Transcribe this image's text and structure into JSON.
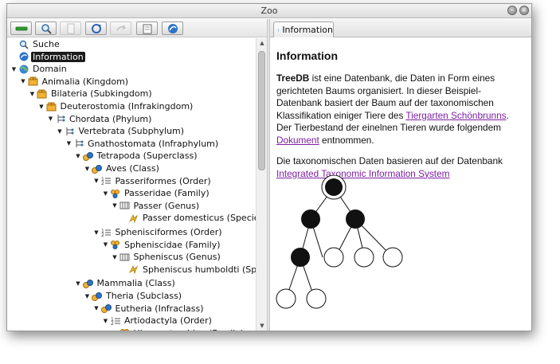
{
  "window": {
    "title": "Zoo"
  },
  "toolbar": {
    "buttons": [
      "minus",
      "search",
      "page",
      "refresh",
      "forward",
      "folder",
      "info"
    ]
  },
  "tree": [
    {
      "label": "Suche",
      "icon": "search",
      "arrow": "",
      "indent": 0,
      "selected": false
    },
    {
      "label": "Information",
      "icon": "info",
      "arrow": "",
      "indent": 0,
      "selected": true
    },
    {
      "label": "Domain",
      "icon": "globe",
      "arrow": "down",
      "indent": 0,
      "selected": false
    },
    {
      "label": "Animalia (Kingdom)",
      "icon": "kingdom",
      "arrow": "down",
      "indent": 1,
      "selected": false
    },
    {
      "label": "Bilateria (Subkingdom)",
      "icon": "kingdom",
      "arrow": "down",
      "indent": 2,
      "selected": false
    },
    {
      "label": "Deuterostomia (Infrakingdom)",
      "icon": "kingdom",
      "arrow": "down",
      "indent": 3,
      "selected": false
    },
    {
      "label": "Chordata (Phylum)",
      "icon": "phylum",
      "arrow": "down",
      "indent": 4,
      "selected": false
    },
    {
      "label": "Vertebrata (Subphylum)",
      "icon": "phylum",
      "arrow": "down",
      "indent": 5,
      "selected": false
    },
    {
      "label": "Gnathostomata (Infraphylum)",
      "icon": "phylum",
      "arrow": "down",
      "indent": 6,
      "selected": false
    },
    {
      "label": "Tetrapoda (Superclass)",
      "icon": "class",
      "arrow": "down",
      "indent": 7,
      "selected": false
    },
    {
      "label": "Aves (Class)",
      "icon": "class",
      "arrow": "down",
      "indent": 8,
      "selected": false
    },
    {
      "label": "Passeriformes (Order)",
      "icon": "order",
      "arrow": "down",
      "indent": 9,
      "selected": false
    },
    {
      "label": "Passeridae (Family)",
      "icon": "family",
      "arrow": "down",
      "indent": 10,
      "selected": false
    },
    {
      "label": "Passer (Genus)",
      "icon": "genus",
      "arrow": "down",
      "indent": 11,
      "selected": false
    },
    {
      "label": "Passer domesticus (Species)",
      "icon": "species",
      "arrow": "",
      "indent": 12,
      "selected": false
    },
    {
      "label": "Sphenisciformes (Order)",
      "icon": "order",
      "arrow": "down",
      "indent": 9,
      "selected": false,
      "gap": true
    },
    {
      "label": "Spheniscidae (Family)",
      "icon": "family",
      "arrow": "down",
      "indent": 10,
      "selected": false
    },
    {
      "label": "Spheniscus (Genus)",
      "icon": "genus",
      "arrow": "down",
      "indent": 11,
      "selected": false
    },
    {
      "label": "Spheniscus humboldti (Species)",
      "icon": "species",
      "arrow": "",
      "indent": 12,
      "selected": false
    },
    {
      "label": "Mammalia (Class)",
      "icon": "class",
      "arrow": "down",
      "indent": 7,
      "selected": false,
      "gap": true
    },
    {
      "label": "Theria (Subclass)",
      "icon": "class",
      "arrow": "down",
      "indent": 8,
      "selected": false
    },
    {
      "label": "Eutheria (Infraclass)",
      "icon": "class",
      "arrow": "down",
      "indent": 9,
      "selected": false
    },
    {
      "label": "Artiodactyla (Order)",
      "icon": "order",
      "arrow": "down",
      "indent": 10,
      "selected": false
    },
    {
      "label": "Hippopotamidae (Family)",
      "icon": "family",
      "arrow": "down",
      "indent": 11,
      "selected": false
    }
  ],
  "tab": {
    "label": "Information"
  },
  "info": {
    "heading": "Information",
    "p1_strong": "TreeDB",
    "p1_a": " ist eine Datenbank, die Daten in Form eines gerichteten Baums organisiert. In dieser Beispiel-Datenbank basiert der Baum auf der taxonomischen Klassifikation einiger Tiere des ",
    "link1": "Tiergarten Schönbrunns",
    "p1_b": ". Der Tierbestand der einelnen Tieren wurde folgendem ",
    "link2": "Dokument",
    "p1_c": " entnommen.",
    "p2_a": "Die taxonomischen Daten basieren auf der Datenbank ",
    "link3": "Integrated Taxonomic Information System"
  },
  "colors": {
    "link": "#7b1fa2",
    "selection": "#1b1b1b"
  }
}
